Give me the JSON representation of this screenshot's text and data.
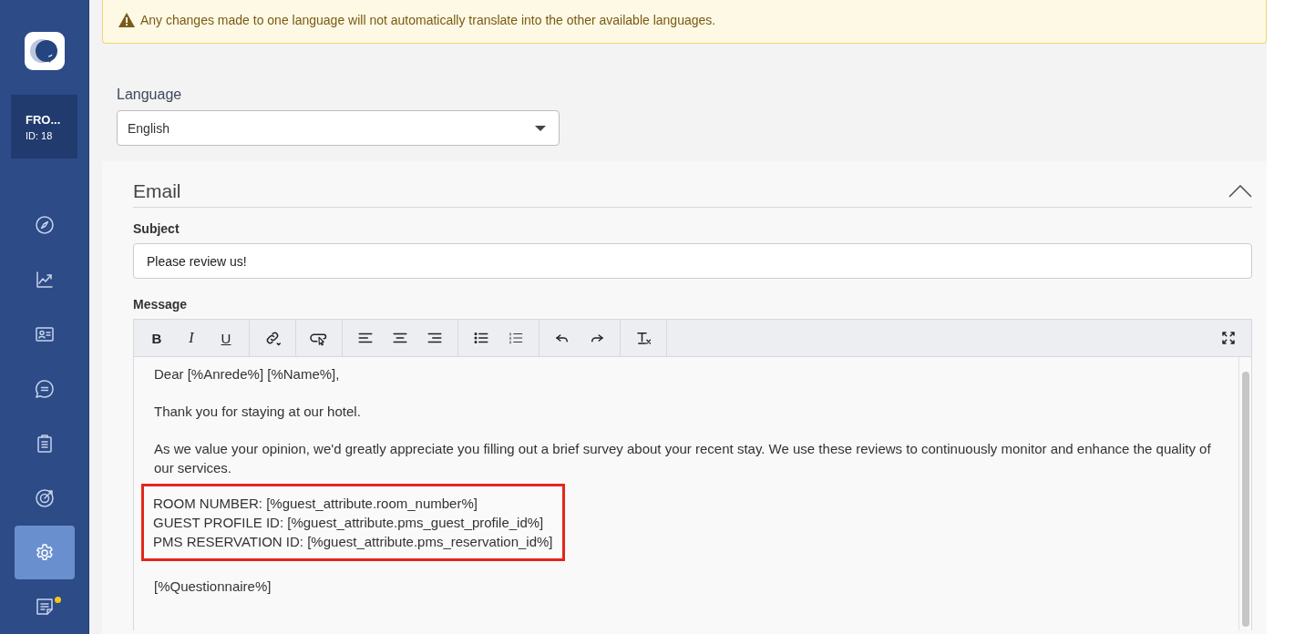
{
  "sidebar": {
    "account": {
      "name": "FRO...",
      "id": "ID: 18"
    },
    "nav": [
      {
        "selected": false,
        "badge": false
      },
      {
        "selected": false,
        "badge": false
      },
      {
        "selected": false,
        "badge": false
      },
      {
        "selected": false,
        "badge": false
      },
      {
        "selected": false,
        "badge": false
      },
      {
        "selected": false,
        "badge": false
      },
      {
        "selected": true,
        "badge": false
      },
      {
        "selected": false,
        "badge": true
      }
    ]
  },
  "warning": "Any changes made to one language will not automatically translate into the other available languages.",
  "language": {
    "label": "Language",
    "value": "English"
  },
  "email": {
    "title": "Email",
    "expanded": true,
    "subject": {
      "label": "Subject",
      "value": "Please review us!"
    },
    "message": {
      "label": "Message",
      "format_buttons": [
        "B",
        "I",
        "U"
      ],
      "paragraphs": [
        {
          "highlighted": false,
          "lines": [
            "Dear [%Anrede%] [%Name%],"
          ]
        },
        {
          "highlighted": false,
          "lines": [
            "Thank you for staying at our hotel."
          ]
        },
        {
          "highlighted": false,
          "lines": [
            "As we value your opinion, we'd greatly appreciate you filling out a brief survey about your recent stay. We use these reviews to continuously monitor and enhance the quality of our services."
          ]
        },
        {
          "highlighted": true,
          "lines": [
            "ROOM NUMBER: [%guest_attribute.room_number%]",
            "GUEST PROFILE ID: [%guest_attribute.pms_guest_profile_id%]",
            "PMS RESERVATION ID: [%guest_attribute.pms_reservation_id%]"
          ]
        },
        {
          "highlighted": false,
          "lines": [
            "[%Questionnaire%]"
          ]
        }
      ]
    }
  }
}
